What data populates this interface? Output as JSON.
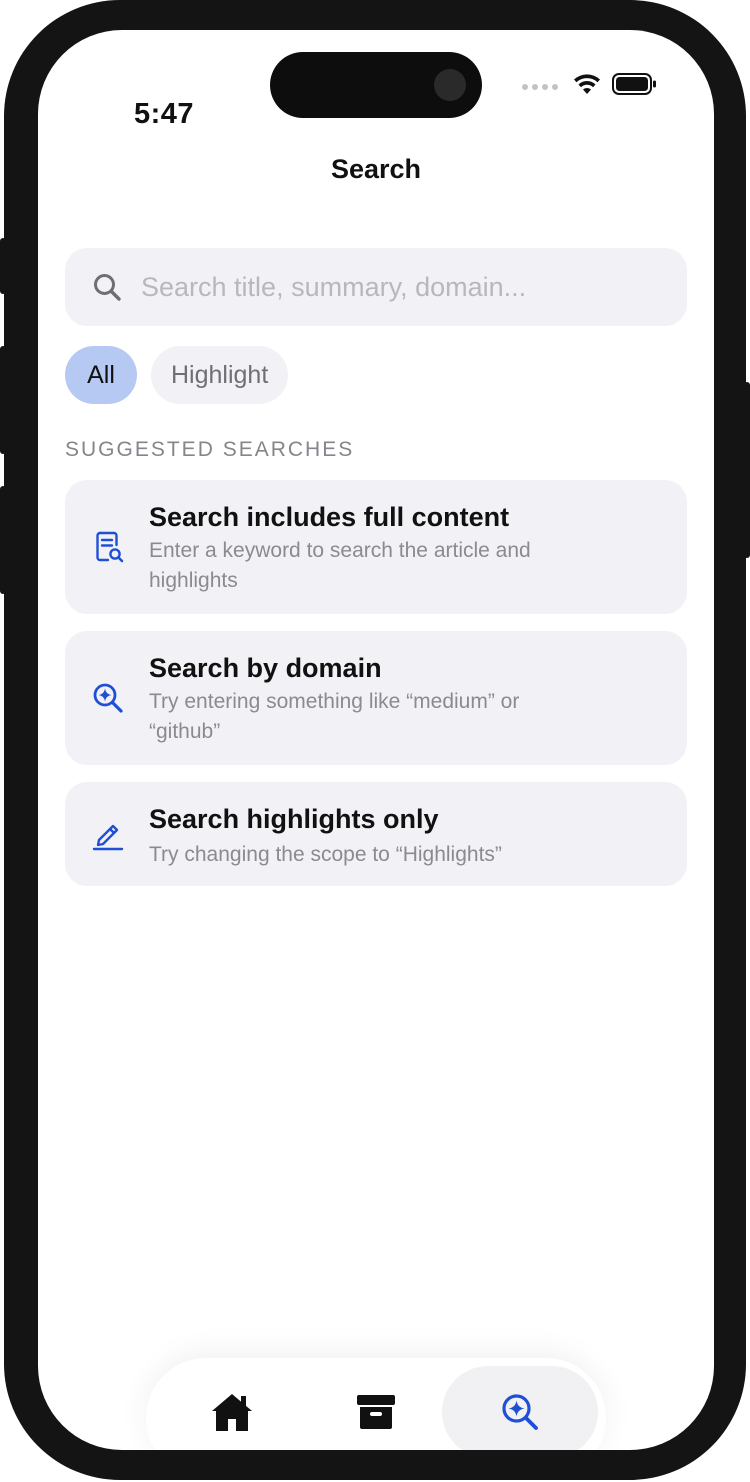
{
  "status_bar": {
    "time": "5:47"
  },
  "header": {
    "title": "Search"
  },
  "search": {
    "placeholder": "Search title, summary, domain...",
    "value": ""
  },
  "scope_chips": [
    {
      "label": "All",
      "selected": true
    },
    {
      "label": "Highlight",
      "selected": false
    }
  ],
  "suggestions": {
    "section_title": "SUGGESTED SEARCHES",
    "items": [
      {
        "icon": "document-search-icon",
        "title": "Search includes full content",
        "description": "Enter a keyword to search the article and highlights"
      },
      {
        "icon": "zoom-sparkle-icon",
        "title": "Search by domain",
        "description": "Try entering something like “medium” or “github”"
      },
      {
        "icon": "pencil-icon",
        "title": "Search highlights only",
        "description": "Try changing the scope to “Highlights”"
      }
    ]
  },
  "tab_bar": {
    "tabs": [
      {
        "icon": "home-icon",
        "selected": false
      },
      {
        "icon": "archive-icon",
        "selected": false
      },
      {
        "icon": "search-sparkle-icon",
        "selected": true
      }
    ]
  },
  "colors": {
    "accent": "#1f4fd6",
    "chip_active": "#b6c9f3",
    "card_background": "#f2f2f6"
  }
}
